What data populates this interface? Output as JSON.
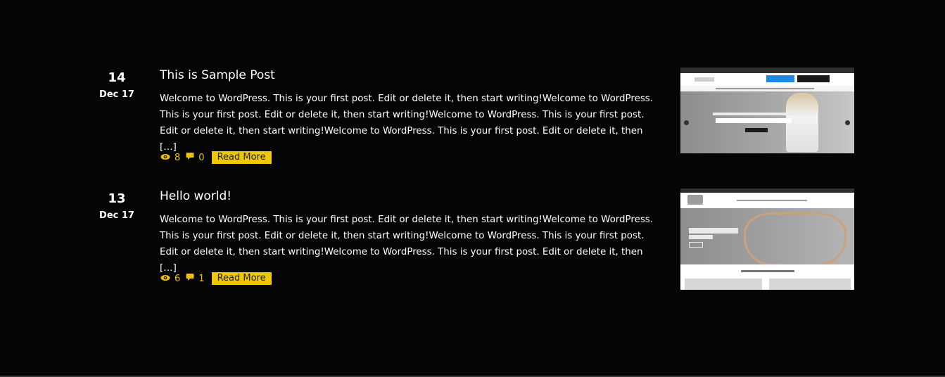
{
  "posts": [
    {
      "day": "14",
      "month": "Dec 17",
      "title": "This is Sample Post",
      "excerpt": "Welcome to WordPress. This is your first post. Edit or delete it, then start writing!Welcome to WordPress. This is your first post. Edit or delete it, then start writing!Welcome to WordPress. This is your first post. Edit or delete it, then start writing!Welcome to WordPress. This is your first post. Edit or delete it, then […]",
      "views": "8",
      "comments": "0",
      "read_more": "Read More",
      "thumbnail_icon": "master-plan-seminar-screenshot"
    },
    {
      "day": "13",
      "month": "Dec 17",
      "title": "Hello world!",
      "excerpt": "Welcome to WordPress. This is your first post. Edit or delete it, then start writing!Welcome to WordPress. This is your first post. Edit or delete it, then start writing!Welcome to WordPress. This is your first post. Edit or delete it, then start writing!Welcome to WordPress. This is your first post. Edit or delete it, then […]",
      "views": "6",
      "comments": "1",
      "read_more": "Read More",
      "thumbnail_icon": "jewelry-store-screenshot"
    }
  ],
  "icons": {
    "views": "eye-icon",
    "comments": "comment-icon"
  },
  "colors": {
    "background": "#050505",
    "accent": "#f0c800",
    "text": "#ffffff"
  }
}
